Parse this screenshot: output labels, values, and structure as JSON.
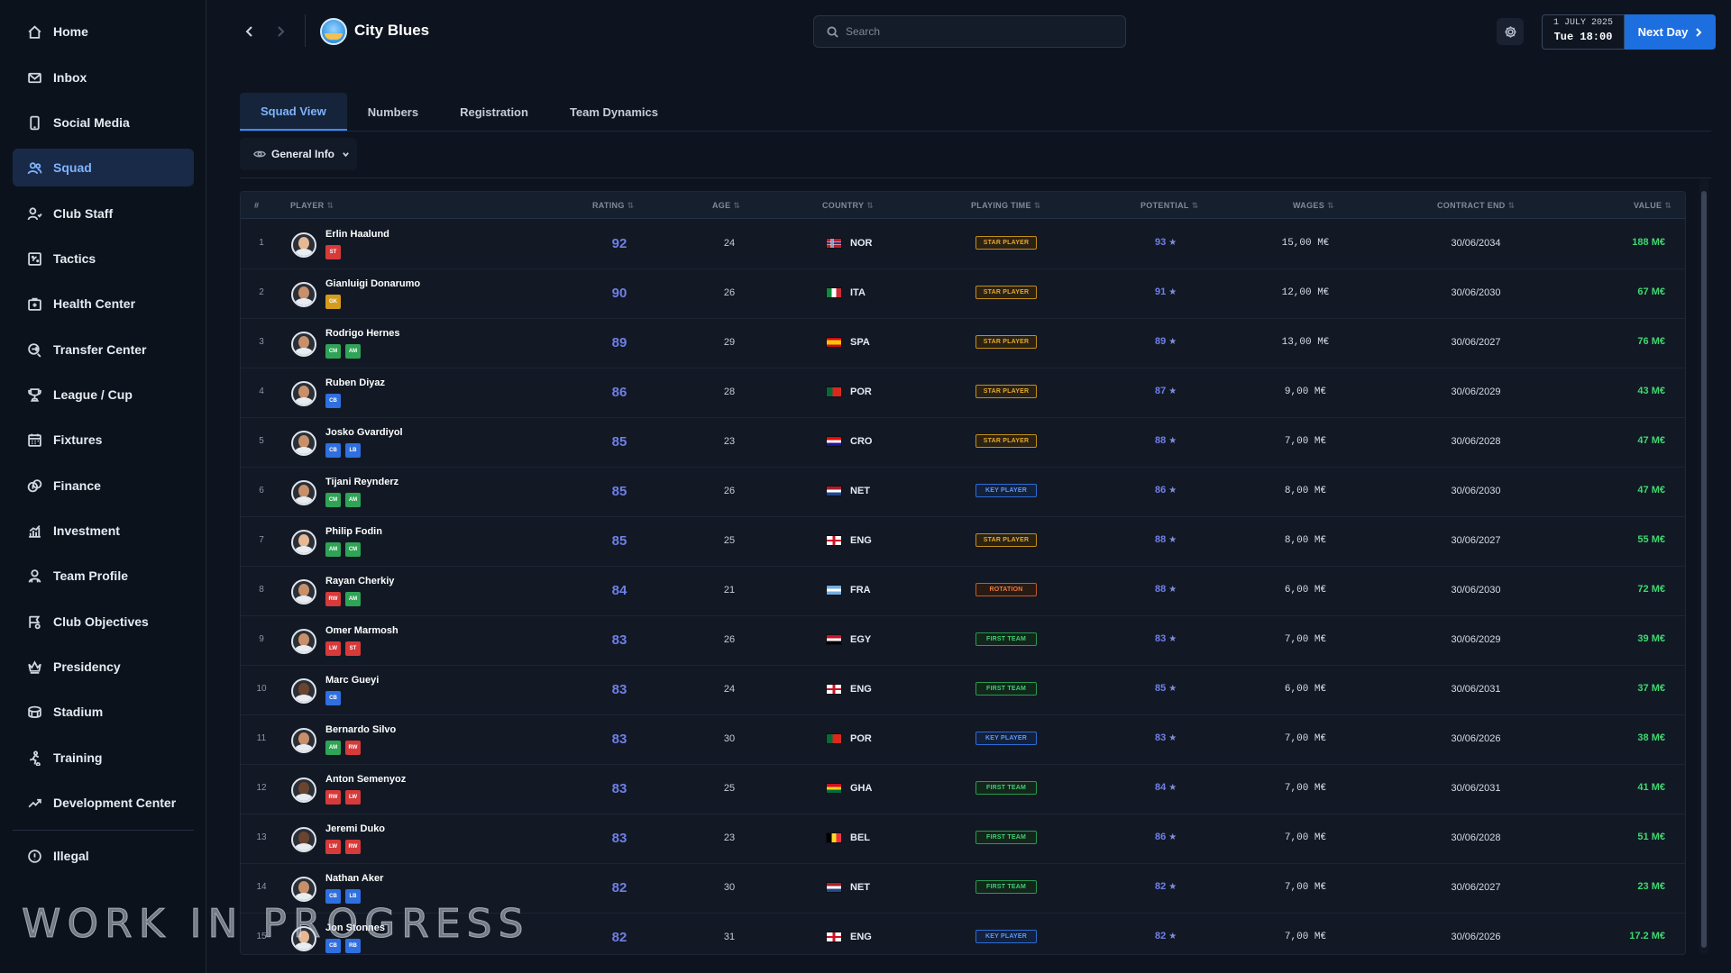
{
  "sidebar": {
    "items": [
      {
        "label": "Home",
        "icon": "home-icon",
        "active": false
      },
      {
        "label": "Inbox",
        "icon": "inbox-icon",
        "active": false
      },
      {
        "label": "Social Media",
        "icon": "phone-icon",
        "active": false
      },
      {
        "label": "Squad",
        "icon": "users-icon",
        "active": true
      },
      {
        "label": "Club Staff",
        "icon": "staff-icon",
        "active": false
      },
      {
        "label": "Tactics",
        "icon": "tactics-board-icon",
        "active": false
      },
      {
        "label": "Health Center",
        "icon": "medical-icon",
        "active": false
      },
      {
        "label": "Transfer Center",
        "icon": "transfer-icon",
        "active": false
      },
      {
        "label": "League / Cup",
        "icon": "trophy-icon",
        "active": false
      },
      {
        "label": "Fixtures",
        "icon": "calendar-icon",
        "active": false
      },
      {
        "label": "Finance",
        "icon": "coins-icon",
        "active": false
      },
      {
        "label": "Investment",
        "icon": "investment-chart-icon",
        "active": false
      },
      {
        "label": "Team Profile",
        "icon": "team-profile-icon",
        "active": false
      },
      {
        "label": "Club Objectives",
        "icon": "objectives-icon",
        "active": false
      },
      {
        "label": "Presidency",
        "icon": "crown-icon",
        "active": false
      },
      {
        "label": "Stadium",
        "icon": "stadium-icon",
        "active": false
      },
      {
        "label": "Training",
        "icon": "training-icon",
        "active": false
      },
      {
        "label": "Development Center",
        "icon": "trend-up-icon",
        "active": false
      }
    ],
    "footer_item": {
      "label": "Illegal",
      "icon": "illegal-icon"
    }
  },
  "header": {
    "club_name": "City Blues",
    "search_placeholder": "Search",
    "date_line1": "1 JULY 2025",
    "date_line2": "Tue 18:00",
    "next_day_label": "Next Day"
  },
  "tabs": [
    {
      "label": "Squad View",
      "active": true
    },
    {
      "label": "Numbers",
      "active": false
    },
    {
      "label": "Registration",
      "active": false
    },
    {
      "label": "Team Dynamics",
      "active": false
    }
  ],
  "view_select": {
    "selected": "General Info"
  },
  "table": {
    "columns": [
      "#",
      "PLAYER",
      "RATING",
      "AGE",
      "COUNTRY",
      "PLAYING TIME",
      "POTENTIAL",
      "WAGES",
      "CONTRACT END",
      "VALUE"
    ],
    "rows": [
      {
        "num": "1",
        "name": "Erlin Haalund",
        "positions": [
          {
            "code": "ST",
            "group": "att"
          }
        ],
        "rating": "92",
        "age": "24",
        "flag": "nor",
        "country": "NOR",
        "playing_time": "STAR PLAYER",
        "pt_type": "star",
        "potential": "93",
        "wages": "15,00 M€",
        "contract_end": "30/06/2034",
        "value": "188 M€",
        "skin": "light"
      },
      {
        "num": "2",
        "name": "Gianluigi Donarumo",
        "positions": [
          {
            "code": "GK",
            "group": "gk"
          }
        ],
        "rating": "90",
        "age": "26",
        "flag": "ita",
        "country": "ITA",
        "playing_time": "STAR PLAYER",
        "pt_type": "star",
        "potential": "91",
        "wages": "12,00 M€",
        "contract_end": "30/06/2030",
        "value": "67 M€",
        "skin": "mid"
      },
      {
        "num": "3",
        "name": "Rodrigo Hernes",
        "positions": [
          {
            "code": "CM",
            "group": "mid"
          },
          {
            "code": "AM",
            "group": "mid"
          }
        ],
        "rating": "89",
        "age": "29",
        "flag": "spa",
        "country": "SPA",
        "playing_time": "STAR PLAYER",
        "pt_type": "star",
        "potential": "89",
        "wages": "13,00 M€",
        "contract_end": "30/06/2027",
        "value": "76 M€",
        "skin": "mid"
      },
      {
        "num": "4",
        "name": "Ruben Diyaz",
        "positions": [
          {
            "code": "CB",
            "group": "def"
          }
        ],
        "rating": "86",
        "age": "28",
        "flag": "por",
        "country": "POR",
        "playing_time": "STAR PLAYER",
        "pt_type": "star",
        "potential": "87",
        "wages": "9,00 M€",
        "contract_end": "30/06/2029",
        "value": "43 M€",
        "skin": "mid"
      },
      {
        "num": "5",
        "name": "Josko Gvardiyol",
        "positions": [
          {
            "code": "CB",
            "group": "def"
          },
          {
            "code": "LB",
            "group": "def"
          }
        ],
        "rating": "85",
        "age": "23",
        "flag": "cro",
        "country": "CRO",
        "playing_time": "STAR PLAYER",
        "pt_type": "star",
        "potential": "88",
        "wages": "7,00 M€",
        "contract_end": "30/06/2028",
        "value": "47 M€",
        "skin": "mid"
      },
      {
        "num": "6",
        "name": "Tijani Reynderz",
        "positions": [
          {
            "code": "CM",
            "group": "mid"
          },
          {
            "code": "AM",
            "group": "mid"
          }
        ],
        "rating": "85",
        "age": "26",
        "flag": "net",
        "country": "NET",
        "playing_time": "KEY PLAYER",
        "pt_type": "key",
        "potential": "86",
        "wages": "8,00 M€",
        "contract_end": "30/06/2030",
        "value": "47 M€",
        "skin": "mid"
      },
      {
        "num": "7",
        "name": "Philip Fodin",
        "positions": [
          {
            "code": "AM",
            "group": "mid"
          },
          {
            "code": "CM",
            "group": "mid"
          }
        ],
        "rating": "85",
        "age": "25",
        "flag": "eng",
        "country": "ENG",
        "playing_time": "STAR PLAYER",
        "pt_type": "star",
        "potential": "88",
        "wages": "8,00 M€",
        "contract_end": "30/06/2027",
        "value": "55 M€",
        "skin": "light"
      },
      {
        "num": "8",
        "name": "Rayan Cherkiy",
        "positions": [
          {
            "code": "RW",
            "group": "att"
          },
          {
            "code": "AM",
            "group": "mid"
          }
        ],
        "rating": "84",
        "age": "21",
        "flag": "fra",
        "country": "FRA",
        "playing_time": "ROTATION",
        "pt_type": "rot",
        "potential": "88",
        "wages": "6,00 M€",
        "contract_end": "30/06/2030",
        "value": "72 M€",
        "skin": "mid"
      },
      {
        "num": "9",
        "name": "Omer Marmosh",
        "positions": [
          {
            "code": "LW",
            "group": "att"
          },
          {
            "code": "ST",
            "group": "att"
          }
        ],
        "rating": "83",
        "age": "26",
        "flag": "egy",
        "country": "EGY",
        "playing_time": "FIRST TEAM",
        "pt_type": "first",
        "potential": "83",
        "wages": "7,00 M€",
        "contract_end": "30/06/2029",
        "value": "39 M€",
        "skin": "mid"
      },
      {
        "num": "10",
        "name": "Marc Gueyi",
        "positions": [
          {
            "code": "CB",
            "group": "def"
          }
        ],
        "rating": "83",
        "age": "24",
        "flag": "eng",
        "country": "ENG",
        "playing_time": "FIRST TEAM",
        "pt_type": "first",
        "potential": "85",
        "wages": "6,00 M€",
        "contract_end": "30/06/2031",
        "value": "37 M€",
        "skin": "dark"
      },
      {
        "num": "11",
        "name": "Bernardo Silvo",
        "positions": [
          {
            "code": "AM",
            "group": "mid"
          },
          {
            "code": "RW",
            "group": "att"
          }
        ],
        "rating": "83",
        "age": "30",
        "flag": "por",
        "country": "POR",
        "playing_time": "KEY PLAYER",
        "pt_type": "key",
        "potential": "83",
        "wages": "7,00 M€",
        "contract_end": "30/06/2026",
        "value": "38 M€",
        "skin": "mid"
      },
      {
        "num": "12",
        "name": "Anton Semenyoz",
        "positions": [
          {
            "code": "RW",
            "group": "att"
          },
          {
            "code": "LW",
            "group": "att"
          }
        ],
        "rating": "83",
        "age": "25",
        "flag": "gha",
        "country": "GHA",
        "playing_time": "FIRST TEAM",
        "pt_type": "first",
        "potential": "84",
        "wages": "7,00 M€",
        "contract_end": "30/06/2031",
        "value": "41 M€",
        "skin": "dark"
      },
      {
        "num": "13",
        "name": "Jeremi Duko",
        "positions": [
          {
            "code": "LW",
            "group": "att"
          },
          {
            "code": "RW",
            "group": "att"
          }
        ],
        "rating": "83",
        "age": "23",
        "flag": "bel",
        "country": "BEL",
        "playing_time": "FIRST TEAM",
        "pt_type": "first",
        "potential": "86",
        "wages": "7,00 M€",
        "contract_end": "30/06/2028",
        "value": "51 M€",
        "skin": "dark"
      },
      {
        "num": "14",
        "name": "Nathan Aker",
        "positions": [
          {
            "code": "CB",
            "group": "def"
          },
          {
            "code": "LB",
            "group": "def"
          }
        ],
        "rating": "82",
        "age": "30",
        "flag": "net",
        "country": "NET",
        "playing_time": "FIRST TEAM",
        "pt_type": "first",
        "potential": "82",
        "wages": "7,00 M€",
        "contract_end": "30/06/2027",
        "value": "23 M€",
        "skin": "mid"
      },
      {
        "num": "15",
        "name": "Jon Stonnes",
        "positions": [
          {
            "code": "CB",
            "group": "def"
          },
          {
            "code": "RB",
            "group": "def"
          }
        ],
        "rating": "82",
        "age": "31",
        "flag": "eng",
        "country": "ENG",
        "playing_time": "KEY PLAYER",
        "pt_type": "key",
        "potential": "82",
        "wages": "7,00 M€",
        "contract_end": "30/06/2026",
        "value": "17.2 M€",
        "skin": "light"
      }
    ]
  },
  "watermark": "WORK IN PROGRESS"
}
